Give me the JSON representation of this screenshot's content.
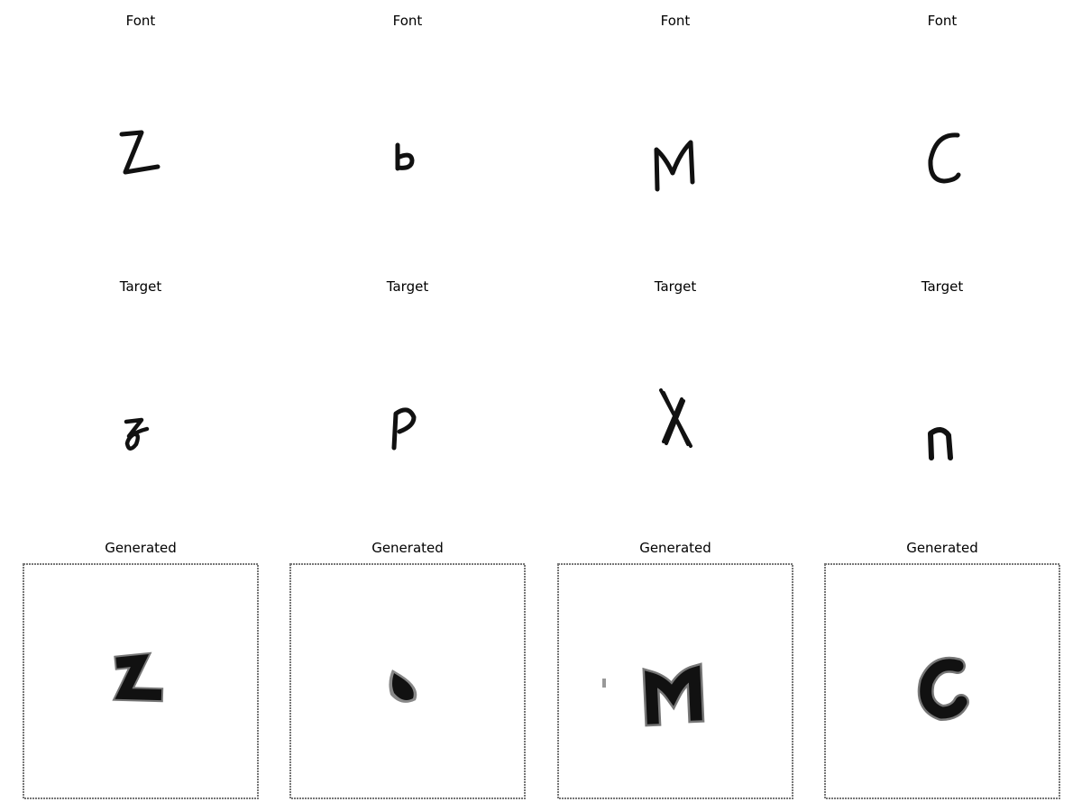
{
  "rows": {
    "font": {
      "titles": [
        "Font",
        "Font",
        "Font",
        "Font"
      ]
    },
    "target": {
      "titles": [
        "Target",
        "Target",
        "Target",
        "Target"
      ]
    },
    "generated": {
      "titles": [
        "Generated",
        "Generated",
        "Generated",
        "Generated"
      ]
    }
  }
}
